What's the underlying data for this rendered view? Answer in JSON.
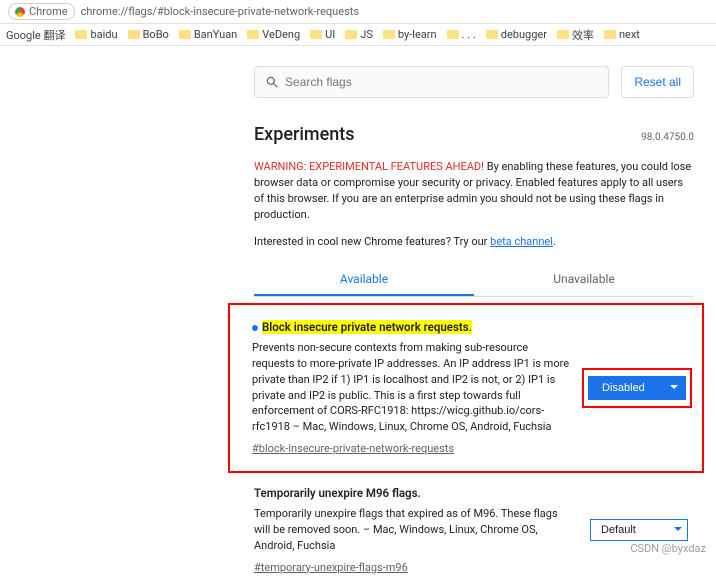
{
  "addr": {
    "scheme": "Chrome",
    "url": "chrome://flags/#block-insecure-private-network-requests"
  },
  "bookmarks": [
    "Google 翻译",
    "baidu",
    "BoBo",
    "BanYuan",
    "VeDeng",
    "UI",
    "JS",
    "by-learn",
    ". . .",
    "debugger",
    "效率",
    "next"
  ],
  "search": {
    "placeholder": "Search flags"
  },
  "reset_label": "Reset all",
  "title": "Experiments",
  "version": "98.0.4750.0",
  "warning_bold": "WARNING: EXPERIMENTAL FEATURES AHEAD!",
  "warning_rest": " By enabling these features, you could lose browser data or compromise your security or privacy. Enabled features apply to all users of this browser. If you are an enterprise admin you should not be using these flags in production.",
  "beta_prefix": "Interested in cool new Chrome features? Try our ",
  "beta_link": "beta channel",
  "tabs": {
    "available": "Available",
    "unavailable": "Unavailable"
  },
  "flag1": {
    "title": "Block insecure private network requests.",
    "desc": "Prevents non-secure contexts from making sub-resource requests to more-private IP addresses. An IP address IP1 is more private than IP2 if 1) IP1 is localhost and IP2 is not, or 2) IP1 is private and IP2 is public. This is a first step towards full enforcement of CORS-RFC1918: https://wicg.github.io/cors-rfc1918 – Mac, Windows, Linux, Chrome OS, Android, Fuchsia",
    "hash": "#block-insecure-private-network-requests",
    "select": "Disabled"
  },
  "flag2": {
    "title": "Temporarily unexpire M96 flags.",
    "desc": "Temporarily unexpire flags that expired as of M96. These flags will be removed soon. – Mac, Windows, Linux, Chrome OS, Android, Fuchsia",
    "hash": "#temporary-unexpire-flags-m96",
    "select": "Default"
  },
  "watermark": "CSDN @byxdaz"
}
